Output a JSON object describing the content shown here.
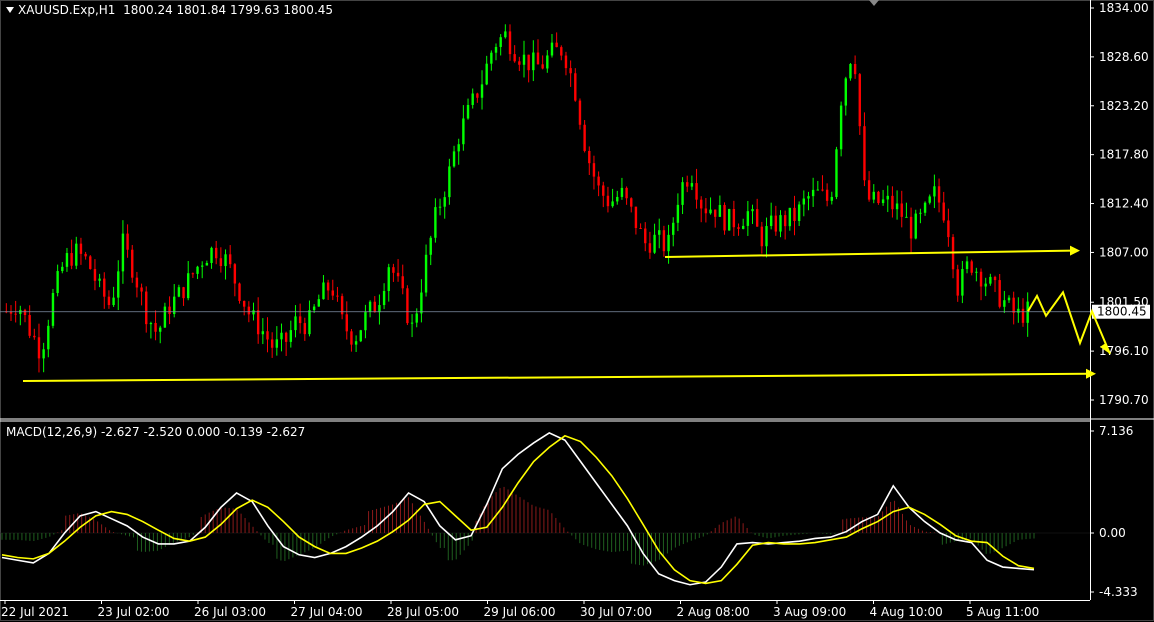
{
  "header": {
    "symbol": "XAUUSD.Exp,H1",
    "ohlc": "1800.24 1801.84 1799.63 1800.45"
  },
  "macd_header": {
    "label": "MACD(12,26,9)",
    "values": "-2.627 -2.520 0.000 -0.139 -2.627"
  },
  "colors": {
    "background": "#000000",
    "bull": "#00ff00",
    "bear": "#ff0000",
    "axis": "#ffffff",
    "annotation": "#ffff00",
    "signal": "#ffff00",
    "macd_line": "#ffffff",
    "hist_pos": "#8b1a1a",
    "hist_neg": "#1f5f1f"
  },
  "chart_data": [
    {
      "type": "candlestick",
      "title": "XAUUSD.Exp,H1",
      "ylim": [
        1789.0,
        1834.0
      ],
      "y_ticks": [
        "1834.00",
        "1828.60",
        "1823.20",
        "1817.80",
        "1812.40",
        "1807.00",
        "1801.50",
        "1796.10",
        "1790.70"
      ],
      "x_ticks": [
        "22 Jul 2021",
        "23 Jul 02:00",
        "26 Jul 03:00",
        "27 Jul 04:00",
        "28 Jul 05:00",
        "29 Jul 06:00",
        "30 Jul 07:00",
        "2 Aug 08:00",
        "3 Aug 09:00",
        "4 Aug 10:00",
        "5 Aug 11:00"
      ],
      "current_price": "1800.45",
      "close_path": [
        1800.5,
        1801.5,
        1798.5,
        1796.0,
        1802.0,
        1806.0,
        1807.0,
        1806.0,
        1803.0,
        1801.0,
        1808.0,
        1805.0,
        1800.5,
        1798.0,
        1801.0,
        1802.5,
        1804.5,
        1806.5,
        1807.5,
        1806.0,
        1803.0,
        1800.0,
        1798.5,
        1796.5,
        1797.0,
        1799.5,
        1799.0,
        1802.0,
        1803.5,
        1799.0,
        1797.5,
        1800.0,
        1801.5,
        1806.0,
        1802.5,
        1798.5,
        1805.0,
        1811.0,
        1815.0,
        1820.0,
        1823.0,
        1826.0,
        1830.0,
        1831.0,
        1829.0,
        1828.0,
        1827.5,
        1829.0,
        1829.5,
        1825.0,
        1818.0,
        1814.0,
        1812.5,
        1813.5,
        1811.0,
        1808.0,
        1808.5,
        1807.5,
        1814.0,
        1816.0,
        1812.0,
        1812.0,
        1810.5,
        1810.5,
        1811.5,
        1808.5,
        1810.0,
        1810.5,
        1811.0,
        1813.0,
        1813.5,
        1812.5,
        1825.0,
        1830.0,
        1813.0,
        1812.5,
        1812.5,
        1811.5,
        1809.5,
        1811.0,
        1813.5,
        1811.0,
        1803.0,
        1806.0,
        1804.5,
        1803.0,
        1801.5,
        1800.0,
        1800.45
      ]
    },
    {
      "type": "macd",
      "series": [
        {
          "name": "MACD(12,26,9)",
          "role": "line",
          "color": "#ffffff"
        },
        {
          "role": "signal",
          "color": "#ffff00"
        }
      ],
      "ylim": [
        -4.333,
        7.136
      ],
      "y_ticks": [
        "7.136",
        "0.00",
        "-4.333"
      ],
      "macd": [
        -1.8,
        -2.0,
        -2.2,
        -1.5,
        0.0,
        1.2,
        1.5,
        1.0,
        0.5,
        -0.3,
        -0.8,
        -0.8,
        -0.6,
        0.4,
        1.8,
        2.8,
        2.2,
        0.5,
        -1.0,
        -1.6,
        -1.8,
        -1.5,
        -1.0,
        -0.3,
        0.5,
        1.5,
        2.8,
        2.2,
        0.5,
        -0.5,
        -0.2,
        2.0,
        4.5,
        5.5,
        6.3,
        7.0,
        6.5,
        5.0,
        3.5,
        2.0,
        0.5,
        -1.5,
        -3.0,
        -3.5,
        -3.8,
        -3.6,
        -2.5,
        -0.8,
        -0.7,
        -0.8,
        -0.7,
        -0.6,
        -0.4,
        -0.3,
        0.1,
        0.8,
        1.3,
        3.3,
        1.8,
        0.8,
        0.0,
        -0.5,
        -0.7,
        -2.0,
        -2.5,
        -2.6,
        -2.7
      ],
      "signal": [
        -1.6,
        -1.8,
        -1.9,
        -1.5,
        -0.6,
        0.4,
        1.2,
        1.5,
        1.3,
        0.8,
        0.2,
        -0.4,
        -0.6,
        -0.3,
        0.6,
        1.7,
        2.3,
        1.8,
        0.8,
        -0.3,
        -1.0,
        -1.5,
        -1.5,
        -1.1,
        -0.6,
        0.1,
        0.9,
        2.0,
        2.2,
        1.2,
        0.2,
        0.4,
        1.8,
        3.5,
        5.0,
        6.0,
        6.8,
        6.4,
        5.3,
        4.0,
        2.4,
        0.6,
        -1.3,
        -2.7,
        -3.5,
        -3.7,
        -3.5,
        -2.3,
        -0.9,
        -0.7,
        -0.8,
        -0.8,
        -0.7,
        -0.5,
        -0.3,
        0.3,
        0.8,
        1.5,
        1.8,
        1.3,
        0.6,
        -0.2,
        -0.6,
        -0.7,
        -1.7,
        -2.4,
        -2.6
      ]
    }
  ],
  "annotations": {
    "support_line": [
      1792.8,
      1793.6
    ],
    "resistance_line": [
      1806.5,
      1807.2
    ],
    "forecast_zigzag": [
      1800.5,
      1802.2,
      1800.0,
      1802.6,
      1797.0,
      1800.5,
      1795.8
    ]
  }
}
